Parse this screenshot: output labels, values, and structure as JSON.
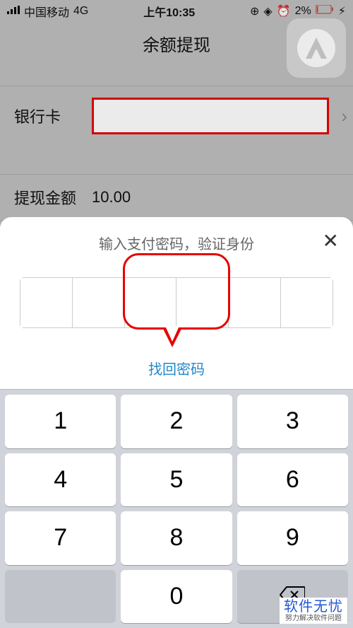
{
  "status": {
    "carrier": "中国移动",
    "network": "4G",
    "time": "上午10:35",
    "battery": "2%"
  },
  "page": {
    "title": "余额提现"
  },
  "rows": {
    "bankcard_label": "银行卡",
    "amount_label": "提现金额",
    "amount_value": "10.00"
  },
  "sheet": {
    "title": "输入支付密码，验证身份",
    "forgot": "找回密码"
  },
  "keypad": {
    "k1": "1",
    "k2": "2",
    "k3": "3",
    "k4": "4",
    "k5": "5",
    "k6": "6",
    "k7": "7",
    "k8": "8",
    "k9": "9",
    "k0": "0"
  },
  "watermark": {
    "title": "软件无忧",
    "sub": "努力解决软件问题"
  }
}
